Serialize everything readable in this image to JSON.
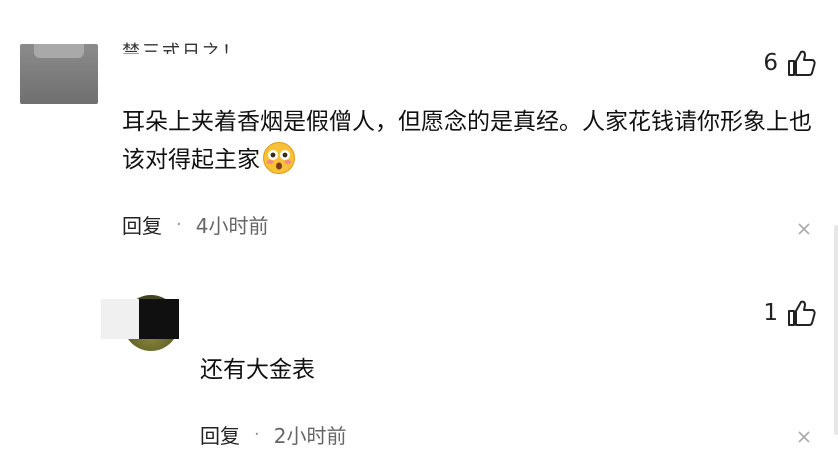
{
  "comments": [
    {
      "username": "禁三式日之！",
      "text": "耳朵上夹着香烟是假僧人，但愿念的是真经。人家花钱请你形象上也该对得起主家",
      "emoji": "flushed-face-emoji",
      "reply_label": "回复",
      "separator": "·",
      "time": "4小时前",
      "likes": "6",
      "like_icon": "thumbs-up-icon",
      "close_icon": "close-icon"
    },
    {
      "text": "还有大金表",
      "reply_label": "回复",
      "separator": "·",
      "time": "2小时前",
      "likes": "1",
      "like_icon": "thumbs-up-icon",
      "close_icon": "close-icon"
    }
  ],
  "colors": {
    "background": "#ffffff",
    "text": "#111111",
    "meta": "#666666"
  }
}
